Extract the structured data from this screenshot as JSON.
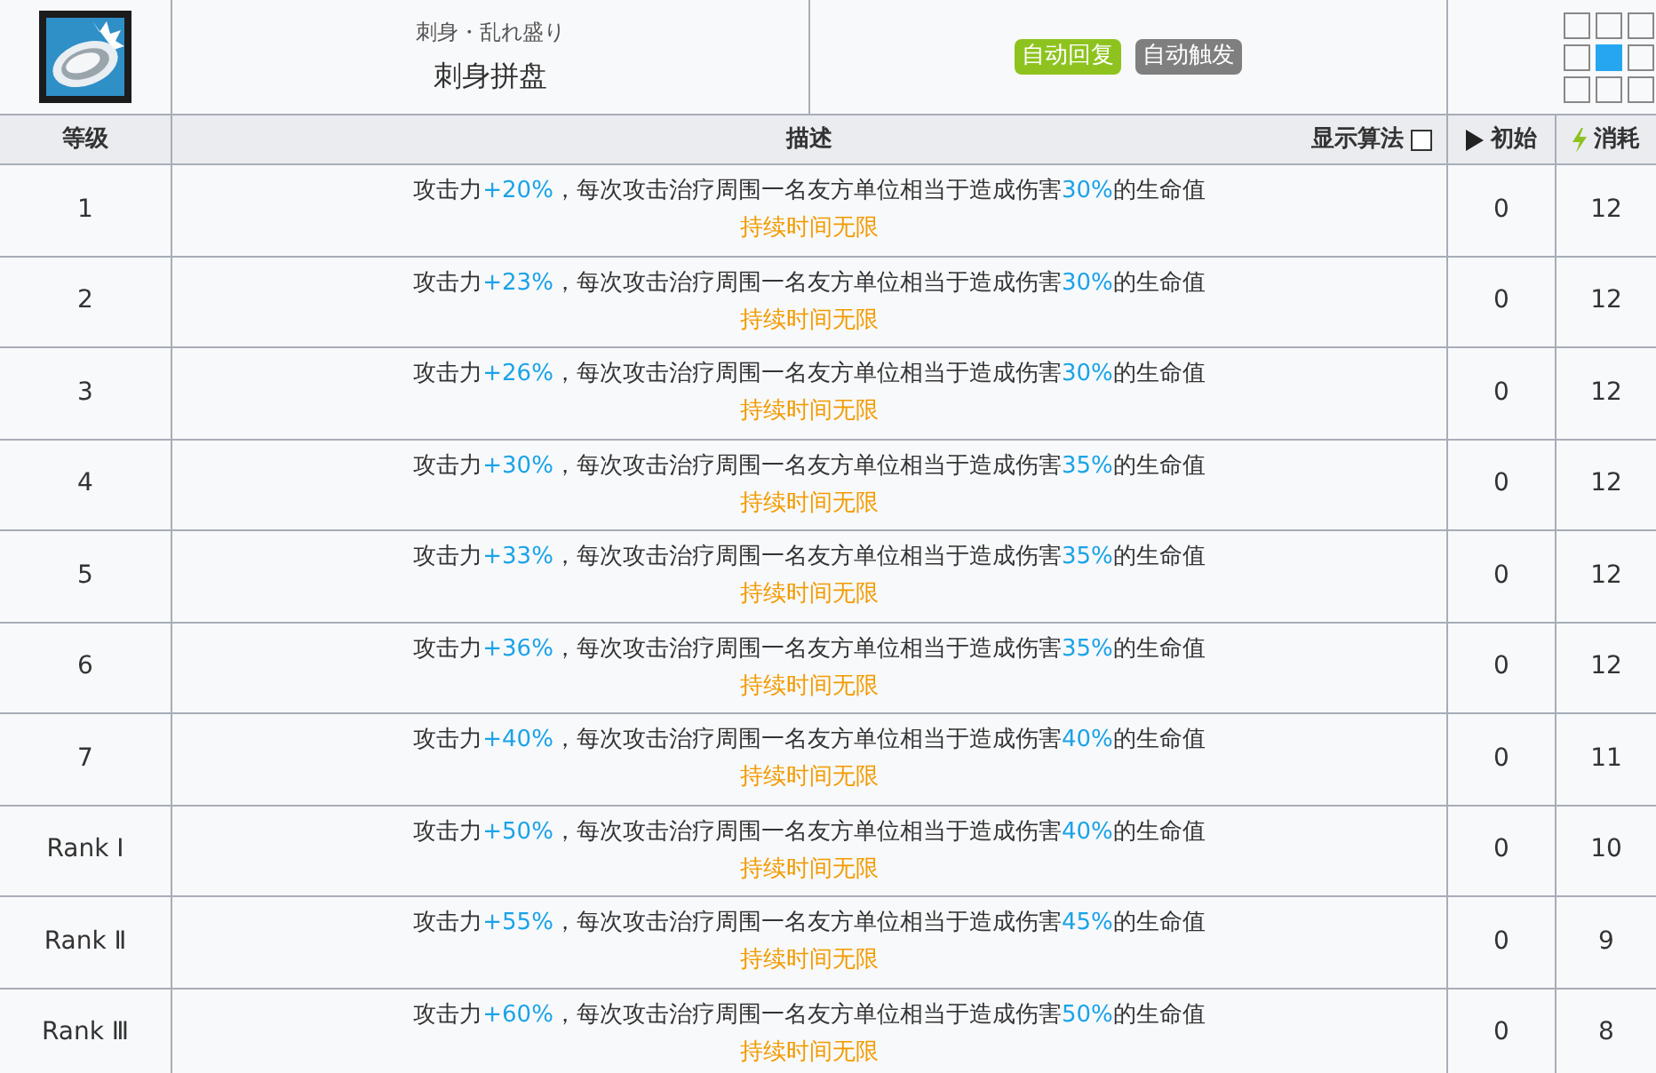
{
  "skill": {
    "subtitle": "刺身・乱れ盛り",
    "name": "刺身拼盘",
    "tags": [
      {
        "label": "自动回复",
        "color": "#8ec31f"
      },
      {
        "label": "自动触发",
        "color": "#7f7f7f"
      }
    ],
    "range": [
      {
        "filled": false
      },
      {
        "filled": false
      },
      {
        "filled": false
      },
      {
        "filled": false
      },
      {
        "filled": true
      },
      {
        "filled": false
      },
      {
        "filled": false
      },
      {
        "filled": false
      },
      {
        "filled": false
      }
    ]
  },
  "table": {
    "columns": {
      "level": "等级",
      "description": "描述",
      "show_formula": {
        "label": "显示算法",
        "checked": false
      },
      "initial": "初始",
      "cost": "消耗"
    },
    "rows": [
      {
        "level": "1",
        "description": [
          {
            "text": "攻击力",
            "kind": "plain"
          },
          {
            "text": "+20%",
            "kind": "value"
          },
          {
            "text": "，每次攻击治疗周围一名友方单位相当于造成伤害",
            "kind": "plain"
          },
          {
            "text": "30%",
            "kind": "value"
          },
          {
            "text": "的生命值",
            "kind": "plain"
          }
        ],
        "duration": "持续时间无限",
        "initial": "0",
        "cost": "12"
      },
      {
        "level": "2",
        "description": [
          {
            "text": "攻击力",
            "kind": "plain"
          },
          {
            "text": "+23%",
            "kind": "value"
          },
          {
            "text": "，每次攻击治疗周围一名友方单位相当于造成伤害",
            "kind": "plain"
          },
          {
            "text": "30%",
            "kind": "value"
          },
          {
            "text": "的生命值",
            "kind": "plain"
          }
        ],
        "duration": "持续时间无限",
        "initial": "0",
        "cost": "12"
      },
      {
        "level": "3",
        "description": [
          {
            "text": "攻击力",
            "kind": "plain"
          },
          {
            "text": "+26%",
            "kind": "value"
          },
          {
            "text": "，每次攻击治疗周围一名友方单位相当于造成伤害",
            "kind": "plain"
          },
          {
            "text": "30%",
            "kind": "value"
          },
          {
            "text": "的生命值",
            "kind": "plain"
          }
        ],
        "duration": "持续时间无限",
        "initial": "0",
        "cost": "12"
      },
      {
        "level": "4",
        "description": [
          {
            "text": "攻击力",
            "kind": "plain"
          },
          {
            "text": "+30%",
            "kind": "value"
          },
          {
            "text": "，每次攻击治疗周围一名友方单位相当于造成伤害",
            "kind": "plain"
          },
          {
            "text": "35%",
            "kind": "value"
          },
          {
            "text": "的生命值",
            "kind": "plain"
          }
        ],
        "duration": "持续时间无限",
        "initial": "0",
        "cost": "12"
      },
      {
        "level": "5",
        "description": [
          {
            "text": "攻击力",
            "kind": "plain"
          },
          {
            "text": "+33%",
            "kind": "value"
          },
          {
            "text": "，每次攻击治疗周围一名友方单位相当于造成伤害",
            "kind": "plain"
          },
          {
            "text": "35%",
            "kind": "value"
          },
          {
            "text": "的生命值",
            "kind": "plain"
          }
        ],
        "duration": "持续时间无限",
        "initial": "0",
        "cost": "12"
      },
      {
        "level": "6",
        "description": [
          {
            "text": "攻击力",
            "kind": "plain"
          },
          {
            "text": "+36%",
            "kind": "value"
          },
          {
            "text": "，每次攻击治疗周围一名友方单位相当于造成伤害",
            "kind": "plain"
          },
          {
            "text": "35%",
            "kind": "value"
          },
          {
            "text": "的生命值",
            "kind": "plain"
          }
        ],
        "duration": "持续时间无限",
        "initial": "0",
        "cost": "12"
      },
      {
        "level": "7",
        "description": [
          {
            "text": "攻击力",
            "kind": "plain"
          },
          {
            "text": "+40%",
            "kind": "value"
          },
          {
            "text": "，每次攻击治疗周围一名友方单位相当于造成伤害",
            "kind": "plain"
          },
          {
            "text": "40%",
            "kind": "value"
          },
          {
            "text": "的生命值",
            "kind": "plain"
          }
        ],
        "duration": "持续时间无限",
        "initial": "0",
        "cost": "11"
      },
      {
        "level": "Rank Ⅰ",
        "description": [
          {
            "text": "攻击力",
            "kind": "plain"
          },
          {
            "text": "+50%",
            "kind": "value"
          },
          {
            "text": "，每次攻击治疗周围一名友方单位相当于造成伤害",
            "kind": "plain"
          },
          {
            "text": "40%",
            "kind": "value"
          },
          {
            "text": "的生命值",
            "kind": "plain"
          }
        ],
        "duration": "持续时间无限",
        "initial": "0",
        "cost": "10"
      },
      {
        "level": "Rank Ⅱ",
        "description": [
          {
            "text": "攻击力",
            "kind": "plain"
          },
          {
            "text": "+55%",
            "kind": "value"
          },
          {
            "text": "，每次攻击治疗周围一名友方单位相当于造成伤害",
            "kind": "plain"
          },
          {
            "text": "45%",
            "kind": "value"
          },
          {
            "text": "的生命值",
            "kind": "plain"
          }
        ],
        "duration": "持续时间无限",
        "initial": "0",
        "cost": "9"
      },
      {
        "level": "Rank Ⅲ",
        "description": [
          {
            "text": "攻击力",
            "kind": "plain"
          },
          {
            "text": "+60%",
            "kind": "value"
          },
          {
            "text": "，每次攻击治疗周围一名友方单位相当于造成伤害",
            "kind": "plain"
          },
          {
            "text": "50%",
            "kind": "value"
          },
          {
            "text": "的生命值",
            "kind": "plain"
          }
        ],
        "duration": "持续时间无限",
        "initial": "0",
        "cost": "8"
      }
    ]
  }
}
